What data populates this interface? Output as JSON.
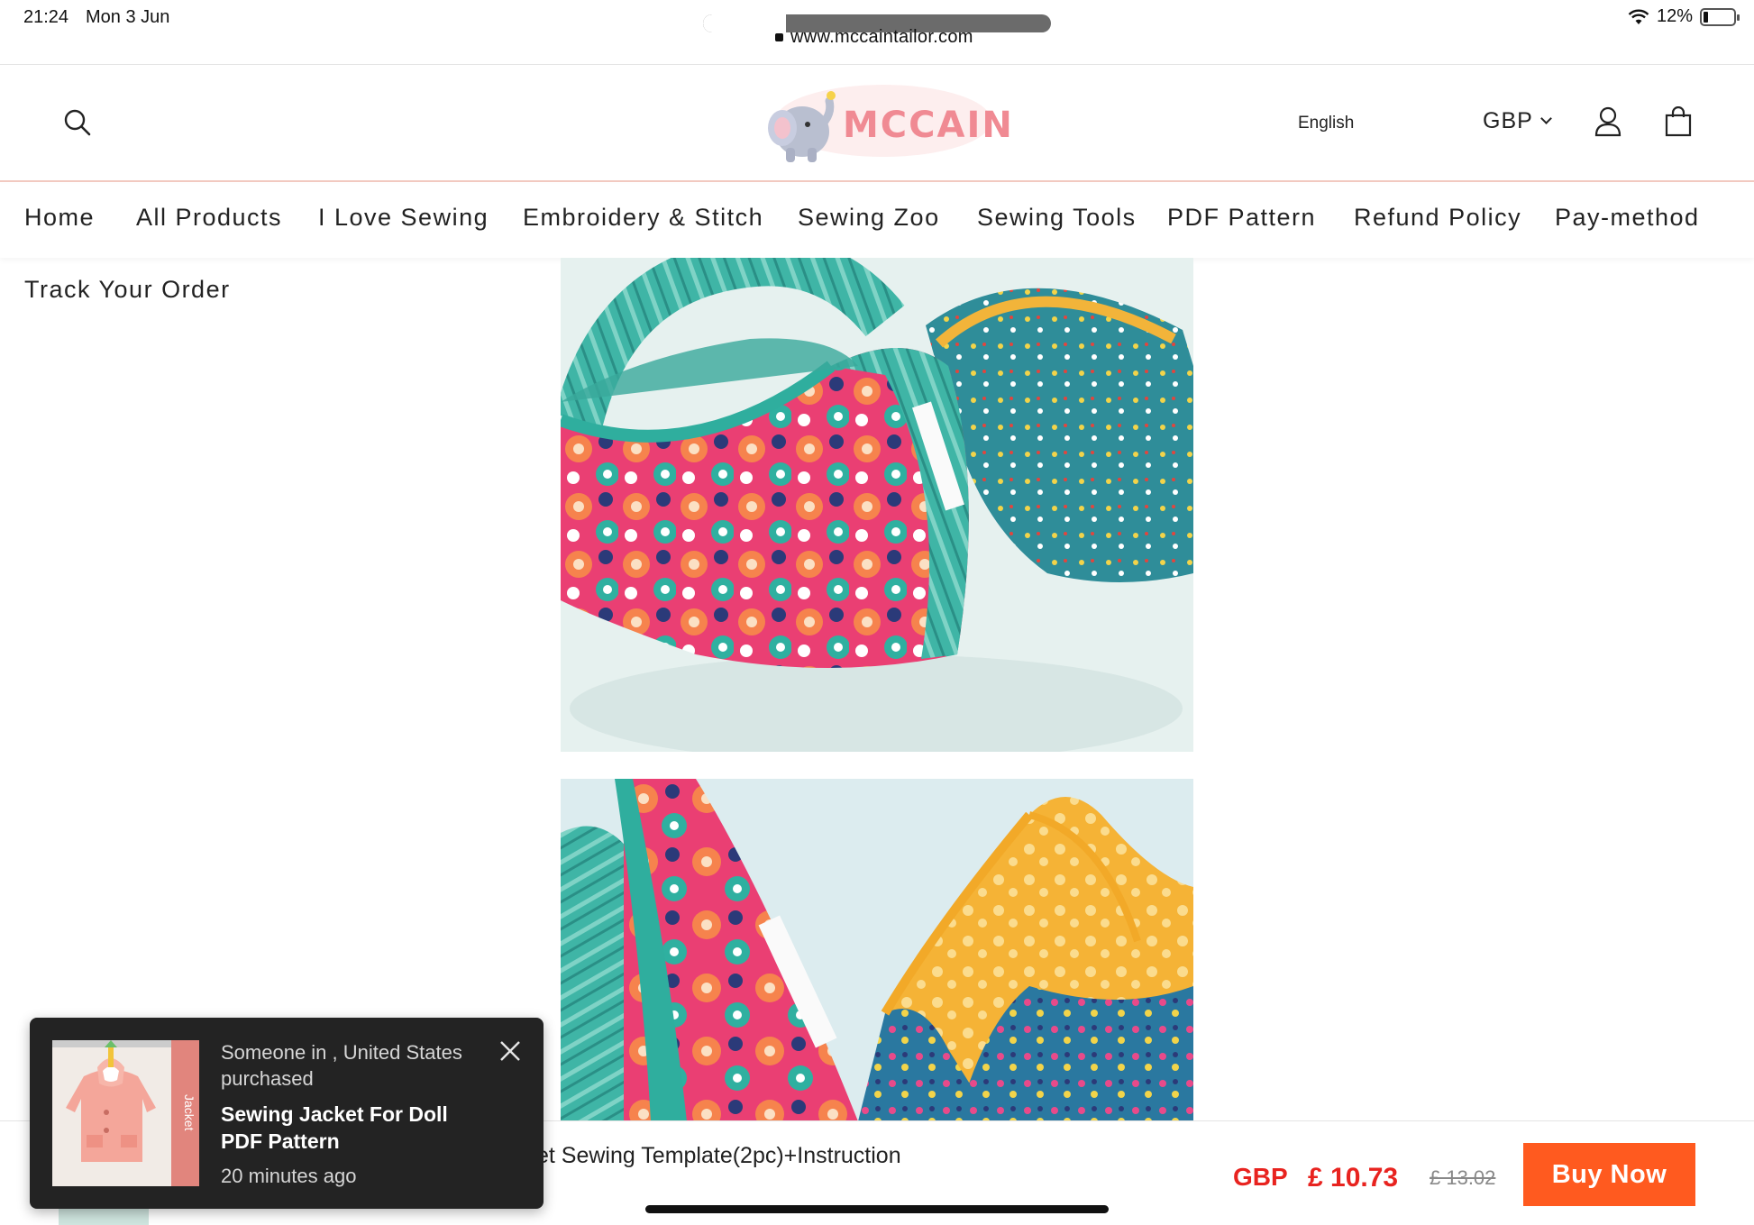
{
  "status_bar": {
    "time": "21:24",
    "date": "Mon 3 Jun",
    "url": "www.mccaintailor.com",
    "battery": "12%"
  },
  "header": {
    "logo_text": "MCCAIN",
    "language": "English",
    "currency": "GBP",
    "icons": [
      "search-icon",
      "user-icon",
      "bag-icon"
    ]
  },
  "nav": {
    "items": [
      {
        "label": "Home"
      },
      {
        "label": "All Products"
      },
      {
        "label": "I Love Sewing"
      },
      {
        "label": "Embroidery & Stitch"
      },
      {
        "label": "Sewing Zoo"
      },
      {
        "label": "Sewing Tools"
      },
      {
        "label": "PDF Pattern"
      },
      {
        "label": "Refund Policy"
      },
      {
        "label": "Pay-method"
      },
      {
        "label": "Track Your Order"
      }
    ]
  },
  "bottom_bar": {
    "title": "et Sewing Template(2pc)+Instruction",
    "currency": "GBP",
    "price": "£ 10.73",
    "old_price": "£ 13.02",
    "buy_label": "Buy Now"
  },
  "popup": {
    "line1": "Someone in , United States",
    "line2": "purchased",
    "product": "Sewing Jacket For Doll PDF Pattern",
    "time_ago": "20 minutes ago",
    "thumb_label": "Jacket"
  },
  "colors": {
    "accent": "#ff5a1f",
    "price": "#e8231f",
    "logo": "#f08a93",
    "popup_bg": "#232323"
  }
}
